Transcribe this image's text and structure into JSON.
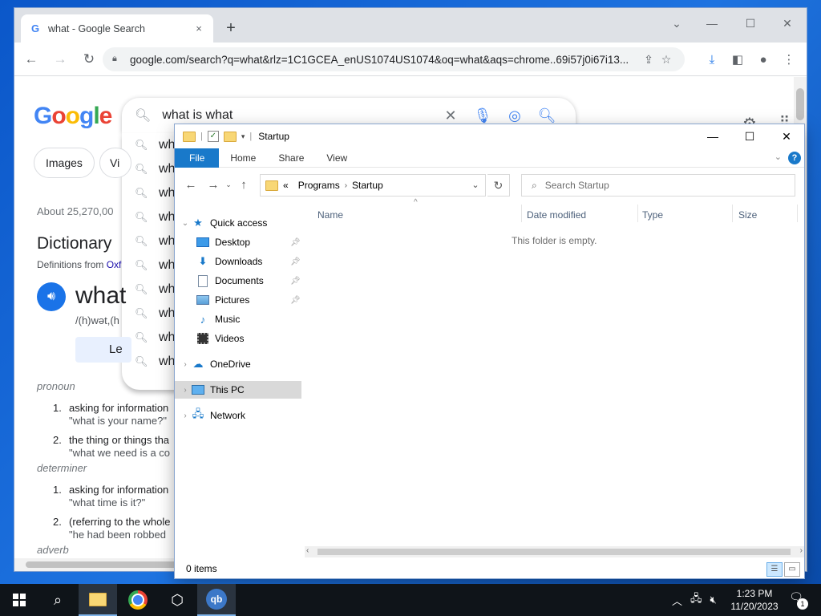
{
  "chrome": {
    "tab_title": "what - Google Search",
    "tab_close": "×",
    "new_tab": "+",
    "url": "google.com/search?q=what&rlz=1C1GCEA_enUS1074US1074&oq=what&aqs=chrome..69i57j0i67i13...",
    "back": "←",
    "forward": "→",
    "reload": "↻"
  },
  "google": {
    "query": "what is what",
    "suggestions": [
      "wh",
      "wh",
      "wh",
      "wh",
      "wh",
      "wh",
      "wh",
      "wh",
      "wh",
      "wh"
    ],
    "chips": [
      "Images",
      "Vi"
    ],
    "results_count": "About 25,270,00",
    "dict_title": "Dictionary",
    "dict_sub_prefix": "Definitions from ",
    "dict_sub_link": "Oxf",
    "word": "what",
    "phonetic": "/(h)wət,(h",
    "learn_label": "Le",
    "pos_pronoun": "pronoun",
    "pos_determiner": "determiner",
    "pos_adverb": "adverb",
    "defs": [
      {
        "num": "1.",
        "text": "asking for information",
        "example": "\"what is your name?\""
      },
      {
        "num": "2.",
        "text": "the thing or things tha",
        "example": "\"what we need is a co"
      },
      {
        "num": "1.",
        "text": "asking for information",
        "example": "\"what time is it?\""
      },
      {
        "num": "2.",
        "text": "(referring to the whole",
        "example": "\"he had been robbed"
      }
    ]
  },
  "explorer": {
    "title": "Startup",
    "ribbon_tabs": [
      "File",
      "Home",
      "Share",
      "View"
    ],
    "crumbs": [
      "Programs",
      "Startup"
    ],
    "crumb_prefix": "«",
    "search_placeholder": "Search Startup",
    "columns": [
      "Name",
      "Date modified",
      "Type",
      "Size"
    ],
    "empty_message": "This folder is empty.",
    "nav": {
      "quick_access": "Quick access",
      "desktop": "Desktop",
      "downloads": "Downloads",
      "documents": "Documents",
      "pictures": "Pictures",
      "music": "Music",
      "videos": "Videos",
      "onedrive": "OneDrive",
      "this_pc": "This PC",
      "network": "Network"
    },
    "status": "0 items"
  },
  "taskbar": {
    "time": "1:23 PM",
    "date": "11/20/2023",
    "notif_count": "1",
    "qb_label": "qb"
  }
}
